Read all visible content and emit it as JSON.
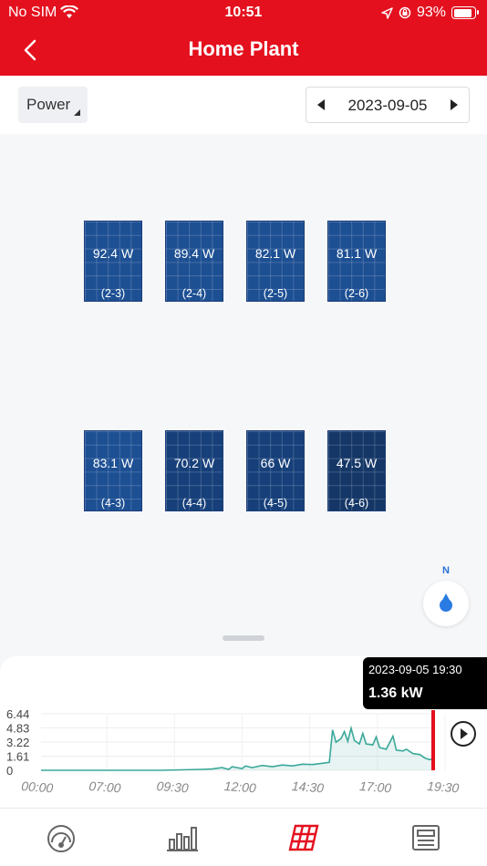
{
  "status_bar": {
    "carrier": "No SIM",
    "time": "10:51",
    "battery": "93%",
    "battery_level": 0.93
  },
  "header": {
    "title": "Home Plant"
  },
  "toolbar": {
    "mode": "Power",
    "date": "2023-09-05"
  },
  "panels": [
    {
      "power": "92.4 W",
      "id": "(2-3)"
    },
    {
      "power": "89.4 W",
      "id": "(2-4)"
    },
    {
      "power": "82.1 W",
      "id": "(2-5)"
    },
    {
      "power": "81.1 W",
      "id": "(2-6)"
    },
    {
      "power": "83.1 W",
      "id": "(4-3)"
    },
    {
      "power": "70.2 W",
      "id": "(4-4)"
    },
    {
      "power": "66 W",
      "id": "(4-5)"
    },
    {
      "power": "47.5 W",
      "id": "(4-6)"
    }
  ],
  "compass": {
    "label": "N"
  },
  "tooltip": {
    "time": "2023-09-05 19:30",
    "value": "1.36 kW"
  },
  "chart_data": {
    "type": "area",
    "y_ticks": [
      "6.44",
      "4.83",
      "3.22",
      "1.61",
      "0"
    ],
    "x_ticks": [
      "00:00",
      "07:00",
      "09:30",
      "12:00",
      "14:30",
      "17:00",
      "19:30"
    ],
    "ylim": [
      0,
      6.44
    ],
    "xlim": [
      0,
      1170
    ],
    "line_color": "#3aa89a",
    "marker_color": "#e4101e",
    "marker_x": 1170,
    "points": [
      [
        0,
        0
      ],
      [
        360,
        0
      ],
      [
        420,
        0.05
      ],
      [
        480,
        0.1
      ],
      [
        510,
        0.15
      ],
      [
        540,
        0.3
      ],
      [
        560,
        0.1
      ],
      [
        570,
        0.4
      ],
      [
        600,
        0.2
      ],
      [
        610,
        0.5
      ],
      [
        630,
        0.3
      ],
      [
        660,
        0.55
      ],
      [
        690,
        0.4
      ],
      [
        720,
        0.6
      ],
      [
        750,
        0.5
      ],
      [
        780,
        0.7
      ],
      [
        810,
        0.65
      ],
      [
        840,
        0.8
      ],
      [
        860,
        0.9
      ],
      [
        870,
        4.6
      ],
      [
        880,
        3.2
      ],
      [
        895,
        3.6
      ],
      [
        905,
        4.4
      ],
      [
        915,
        3.3
      ],
      [
        925,
        4.8
      ],
      [
        935,
        3.4
      ],
      [
        950,
        3.0
      ],
      [
        960,
        4.2
      ],
      [
        970,
        3.0
      ],
      [
        990,
        2.9
      ],
      [
        1000,
        3.8
      ],
      [
        1010,
        2.6
      ],
      [
        1030,
        2.4
      ],
      [
        1050,
        3.9
      ],
      [
        1060,
        2.3
      ],
      [
        1080,
        2.2
      ],
      [
        1090,
        2.4
      ],
      [
        1110,
        1.9
      ],
      [
        1130,
        1.8
      ],
      [
        1145,
        1.4
      ],
      [
        1160,
        1.2
      ],
      [
        1170,
        1.36
      ]
    ]
  }
}
